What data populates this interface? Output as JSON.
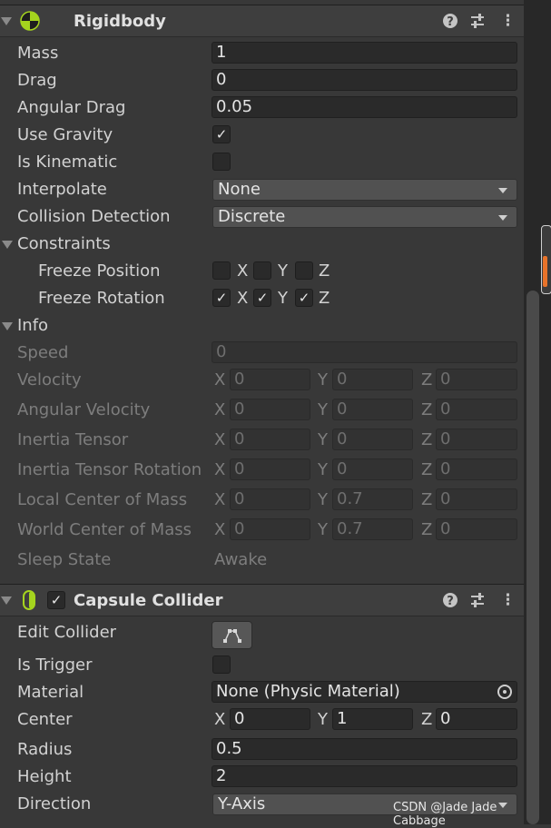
{
  "rigidbody": {
    "title": "Rigidbody",
    "icons": {
      "component": "rigidbody-icon",
      "help": "?",
      "presets": "sliders-icon",
      "menu": "⋮"
    },
    "mass": {
      "label": "Mass",
      "value": "1"
    },
    "drag": {
      "label": "Drag",
      "value": "0"
    },
    "angular_drag": {
      "label": "Angular Drag",
      "value": "0.05"
    },
    "use_gravity": {
      "label": "Use Gravity",
      "checked": true,
      "mark": "✓"
    },
    "is_kinematic": {
      "label": "Is Kinematic",
      "checked": false
    },
    "interpolate": {
      "label": "Interpolate",
      "value": "None"
    },
    "collision_detection": {
      "label": "Collision Detection",
      "value": "Discrete"
    },
    "constraints": {
      "label": "Constraints",
      "freeze_position": {
        "label": "Freeze Position",
        "x": false,
        "y": false,
        "z": false
      },
      "freeze_rotation": {
        "label": "Freeze Rotation",
        "x": true,
        "y": true,
        "z": true,
        "mark": "✓"
      }
    },
    "info": {
      "label": "Info",
      "speed": {
        "label": "Speed",
        "value": "0"
      },
      "velocity": {
        "label": "Velocity",
        "x": "0",
        "y": "0",
        "z": "0"
      },
      "angular_velocity": {
        "label": "Angular Velocity",
        "x": "0",
        "y": "0",
        "z": "0"
      },
      "inertia_tensor": {
        "label": "Inertia Tensor",
        "x": "0",
        "y": "0",
        "z": "0"
      },
      "inertia_tensor_rotation": {
        "label": "Inertia Tensor Rotation",
        "x": "0",
        "y": "0",
        "z": "0"
      },
      "local_center_of_mass": {
        "label": "Local Center of Mass",
        "x": "0",
        "y": "0.7",
        "z": "0"
      },
      "world_center_of_mass": {
        "label": "World Center of Mass",
        "x": "0",
        "y": "0.7",
        "z": "0"
      },
      "sleep_state": {
        "label": "Sleep State",
        "value": "Awake"
      }
    }
  },
  "capsule_collider": {
    "title": "Capsule Collider",
    "enabled": true,
    "enabled_mark": "✓",
    "icons": {
      "component": "capsule-collider-icon",
      "help": "?",
      "presets": "sliders-icon",
      "menu": "⋮"
    },
    "edit_collider": {
      "label": "Edit Collider"
    },
    "is_trigger": {
      "label": "Is Trigger",
      "checked": false
    },
    "material": {
      "label": "Material",
      "value": "None (Physic Material)"
    },
    "center": {
      "label": "Center",
      "x": "0",
      "y": "1",
      "z": "0"
    },
    "radius": {
      "label": "Radius",
      "value": "0.5"
    },
    "height": {
      "label": "Height",
      "value": "2"
    },
    "direction": {
      "label": "Direction",
      "value": "Y-Axis"
    }
  },
  "axis_labels": {
    "x": "X",
    "y": "Y",
    "z": "Z"
  },
  "watermark": "CSDN @Jade Jade Cabbage",
  "colors": {
    "accent_scroll": "#e8732a",
    "rigidbody_icon": "#a5d41e",
    "collider_icon": "#a5d41e",
    "panel_bg": "#383838"
  }
}
